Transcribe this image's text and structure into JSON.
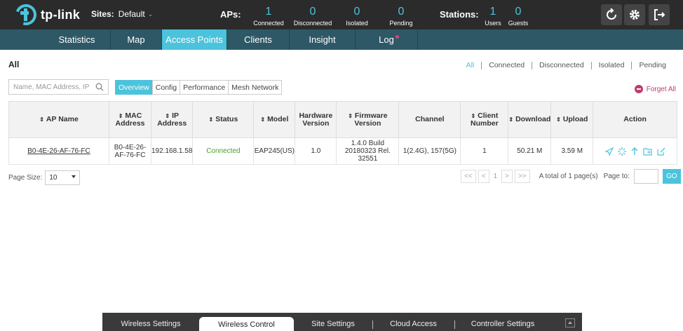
{
  "brand": {
    "name": "tp-link",
    "accent": "#4cc3dc"
  },
  "sites": {
    "label": "Sites:",
    "value": "Default"
  },
  "aps": {
    "label": "APs:",
    "items": [
      {
        "num": "1",
        "label": "Connected"
      },
      {
        "num": "0",
        "label": "Disconnected"
      },
      {
        "num": "0",
        "label": "Isolated"
      },
      {
        "num": "0",
        "label": "Pending"
      }
    ]
  },
  "stations": {
    "label": "Stations:",
    "items": [
      {
        "num": "1",
        "label": "Users"
      },
      {
        "num": "0",
        "label": "Guests"
      }
    ]
  },
  "nav": [
    "Statistics",
    "Map",
    "Access Points",
    "Clients",
    "Insight",
    "Log"
  ],
  "section_title": "All",
  "filters": [
    "All",
    "Connected",
    "Disconnected",
    "Isolated",
    "Pending"
  ],
  "search": {
    "placeholder": "Name, MAC Address, IP"
  },
  "subtabs": [
    "Overview",
    "Config",
    "Performance",
    "Mesh Network"
  ],
  "forget_all": "Forget All",
  "table": {
    "headers": [
      "AP Name",
      "MAC Address",
      "IP Address",
      "Status",
      "Model",
      "Hardware Version",
      "Firmware Version",
      "Channel",
      "Client Number",
      "Download",
      "Upload",
      "Action"
    ],
    "rows": [
      {
        "ap_name": "B0-4E-26-AF-76-FC",
        "mac": "B0-4E-26-AF-76-FC",
        "ip": "192.168.1.58",
        "status": "Connected",
        "model": "EAP245(US)",
        "hw": "1.0",
        "fw": "1.4.0 Build 20180323 Rel. 32551",
        "channel": "1(2.4G), 157(5G)",
        "clients": "1",
        "download": "50.21 M",
        "upload": "3.59 M"
      }
    ]
  },
  "pagination": {
    "page_size_label": "Page Size:",
    "page_size": "10",
    "first": "<<",
    "prev": "<",
    "current": "1",
    "next": ">",
    "last": ">>",
    "total": "A total of 1 page(s)",
    "page_to": "Page to:",
    "go": "GO"
  },
  "bottom_tabs": [
    "Wireless Settings",
    "Wireless Control",
    "Site Settings",
    "Cloud Access",
    "Controller Settings"
  ]
}
